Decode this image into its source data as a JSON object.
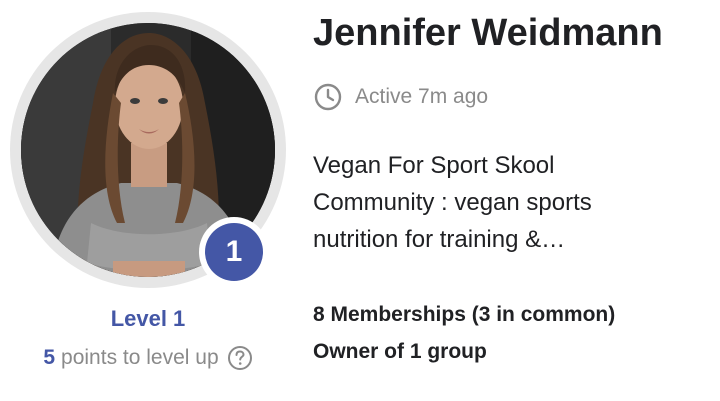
{
  "profile": {
    "name": "Jennifer Weidmann",
    "active_status": "Active 7m ago",
    "bio_lines": [
      "Vegan For Sport Skool",
      "Community : vegan sports",
      "nutrition for training &…"
    ],
    "memberships": "8 Memberships (3 in common)",
    "owner": "Owner of 1 group"
  },
  "level": {
    "badge_number": "1",
    "label": "Level 1",
    "points": "5",
    "points_text": "points to level up"
  },
  "icons": {
    "clock": "clock-icon",
    "help": "question-circle-icon",
    "avatar": "profile-photo"
  },
  "colors": {
    "accent": "#4457a6",
    "muted_text": "#8a8a8a",
    "primary_text": "#202124",
    "ring": "#e6e6e6"
  }
}
